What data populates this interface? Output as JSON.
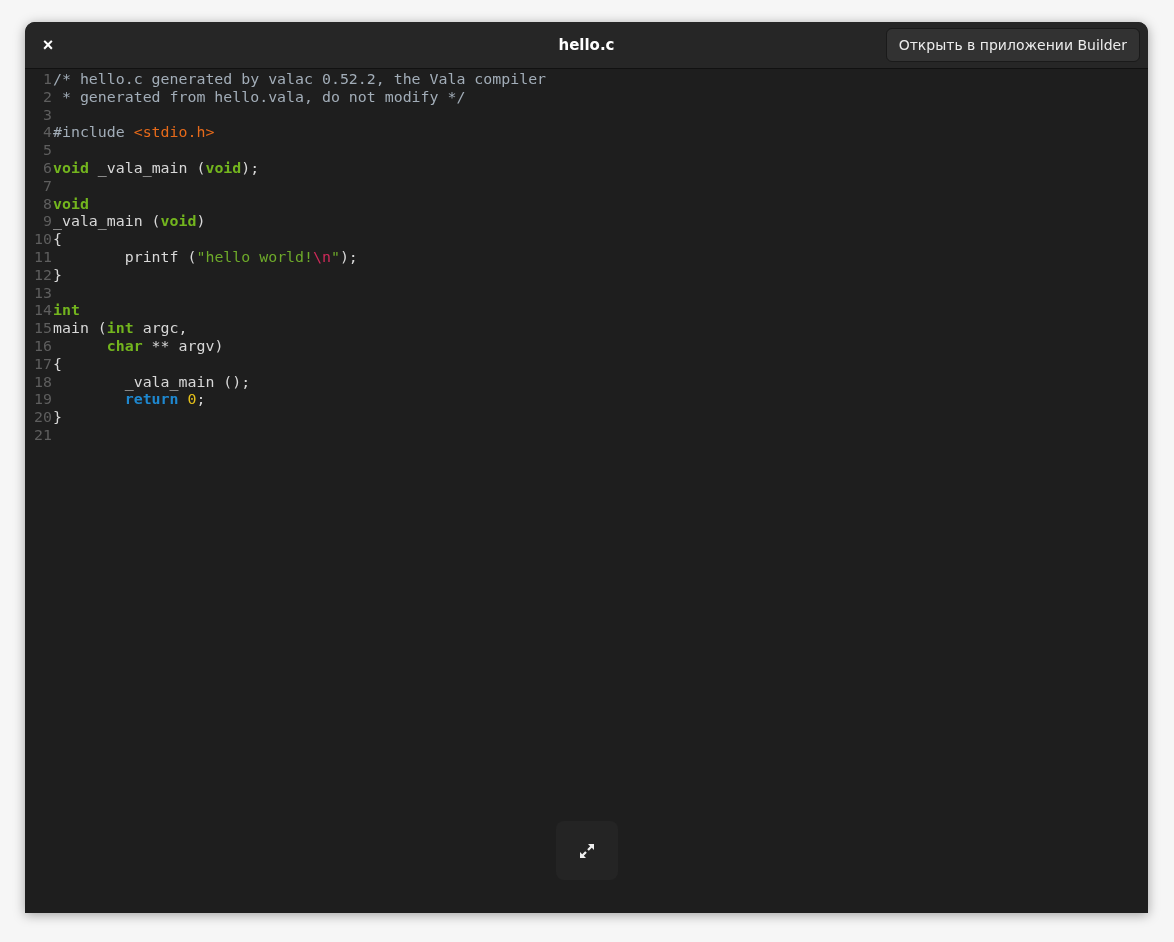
{
  "window": {
    "title": "hello.c",
    "close_label": "×",
    "open_button": "Открыть в приложении Builder"
  },
  "code": {
    "lines": [
      {
        "number": "1",
        "tokens": [
          {
            "kind": "comment",
            "text": "/* hello.c generated by valac 0.52.2, the Vala compiler"
          }
        ]
      },
      {
        "number": "2",
        "tokens": [
          {
            "kind": "comment",
            "text": " * generated from hello.vala, do not modify */"
          }
        ]
      },
      {
        "number": "3"
      },
      {
        "number": "4",
        "tokens": [
          {
            "kind": "preproc",
            "text": "#include "
          },
          {
            "kind": "include",
            "text": "<stdio.h>"
          }
        ]
      },
      {
        "number": "5"
      },
      {
        "number": "6",
        "tokens": [
          {
            "kind": "type",
            "text": "void"
          },
          {
            "kind": "plain",
            "text": " _vala_main ("
          },
          {
            "kind": "type",
            "text": "void"
          },
          {
            "kind": "plain",
            "text": ");"
          }
        ]
      },
      {
        "number": "7"
      },
      {
        "number": "8",
        "tokens": [
          {
            "kind": "type",
            "text": "void"
          }
        ]
      },
      {
        "number": "9",
        "tokens": [
          {
            "kind": "plain",
            "text": "_vala_main ("
          },
          {
            "kind": "type",
            "text": "void"
          },
          {
            "kind": "plain",
            "text": ")"
          }
        ]
      },
      {
        "number": "10",
        "tokens": [
          {
            "kind": "plain",
            "text": "{"
          }
        ]
      },
      {
        "number": "11",
        "tokens": [
          {
            "kind": "plain",
            "text": "        printf ("
          },
          {
            "kind": "string",
            "text": "\"hello world!"
          },
          {
            "kind": "escape",
            "text": "\\n"
          },
          {
            "kind": "string",
            "text": "\""
          },
          {
            "kind": "plain",
            "text": ");"
          }
        ]
      },
      {
        "number": "12",
        "tokens": [
          {
            "kind": "plain",
            "text": "}"
          }
        ]
      },
      {
        "number": "13"
      },
      {
        "number": "14",
        "tokens": [
          {
            "kind": "type",
            "text": "int"
          }
        ]
      },
      {
        "number": "15",
        "tokens": [
          {
            "kind": "plain",
            "text": "main ("
          },
          {
            "kind": "type",
            "text": "int"
          },
          {
            "kind": "plain",
            "text": " argc,"
          }
        ]
      },
      {
        "number": "16",
        "tokens": [
          {
            "kind": "type",
            "text": "      char"
          },
          {
            "kind": "plain",
            "text": " ** argv)"
          }
        ]
      },
      {
        "number": "17",
        "tokens": [
          {
            "kind": "plain",
            "text": "{"
          }
        ]
      },
      {
        "number": "18",
        "tokens": [
          {
            "kind": "plain",
            "text": "        _vala_main ();"
          }
        ]
      },
      {
        "number": "19",
        "tokens": [
          {
            "kind": "keyword",
            "text": "        return"
          },
          {
            "kind": "number",
            "text": " 0"
          },
          {
            "kind": "plain",
            "text": ";"
          }
        ]
      },
      {
        "number": "20",
        "tokens": [
          {
            "kind": "plain",
            "text": "}"
          }
        ]
      },
      {
        "number": "21"
      }
    ]
  }
}
